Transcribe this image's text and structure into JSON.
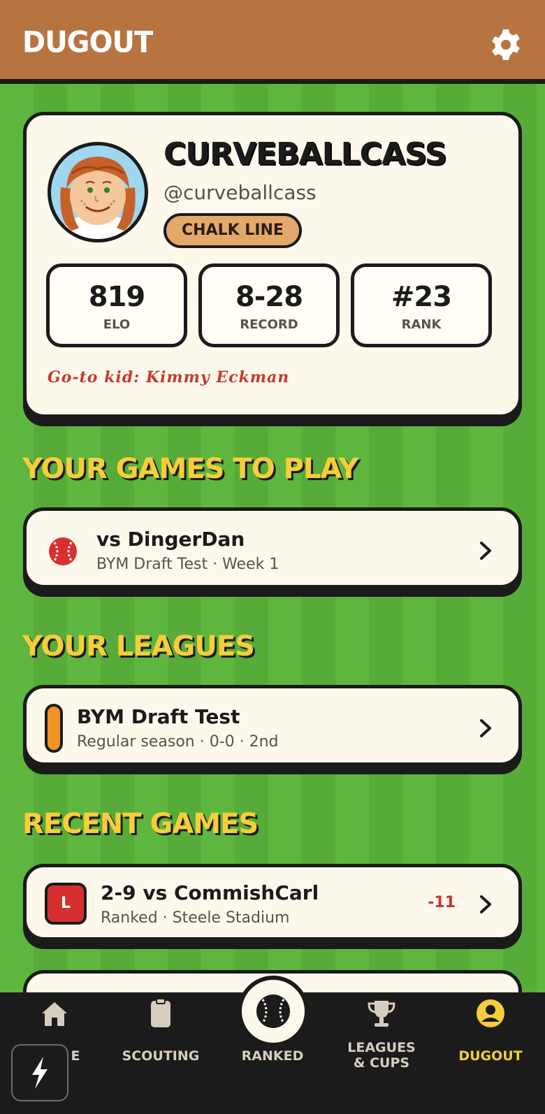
{
  "header": {
    "title": "DUGOUT",
    "settings_icon": "gear-icon"
  },
  "profile": {
    "display_name": "CURVEBALLCASS",
    "handle": "@curveballcass",
    "badge": "CHALK LINE",
    "stats": [
      {
        "value": "819",
        "label": "ELO"
      },
      {
        "value": "8-28",
        "label": "RECORD"
      },
      {
        "value": "#23",
        "label": "RANK"
      }
    ],
    "goto_kid": "Go-to kid: Kimmy Eckman"
  },
  "games_to_play": {
    "title": "YOUR GAMES TO PLAY",
    "items": [
      {
        "title": "vs DingerDan",
        "subtitle": "BYM Draft Test · Week 1"
      }
    ]
  },
  "leagues": {
    "title": "YOUR LEAGUES",
    "items": [
      {
        "title": "BYM Draft Test",
        "subtitle": "Regular season · 0-0 · 2nd"
      }
    ]
  },
  "recent_games": {
    "title": "RECENT GAMES",
    "items": [
      {
        "result": "L",
        "title": "2-9 vs CommishCarl",
        "subtitle": "Ranked · Steele Stadium",
        "delta": "-11"
      }
    ]
  },
  "nav": {
    "items": [
      {
        "label": "E",
        "icon": "home-icon"
      },
      {
        "label": "SCOUTING",
        "icon": "clipboard-icon"
      },
      {
        "label": "RANKED",
        "icon": "baseball-icon"
      },
      {
        "label": "LEAGUES\n& CUPS",
        "icon": "trophy-icon"
      },
      {
        "label": "DUGOUT",
        "icon": "user-icon",
        "active": true
      }
    ]
  },
  "colors": {
    "field": "#5fb53f",
    "header": "#b87440",
    "accent_yellow": "#f6cd3b",
    "loss_red": "#d42f2f",
    "active_nav": "#f6cd3b",
    "card": "#fdf8ec"
  }
}
